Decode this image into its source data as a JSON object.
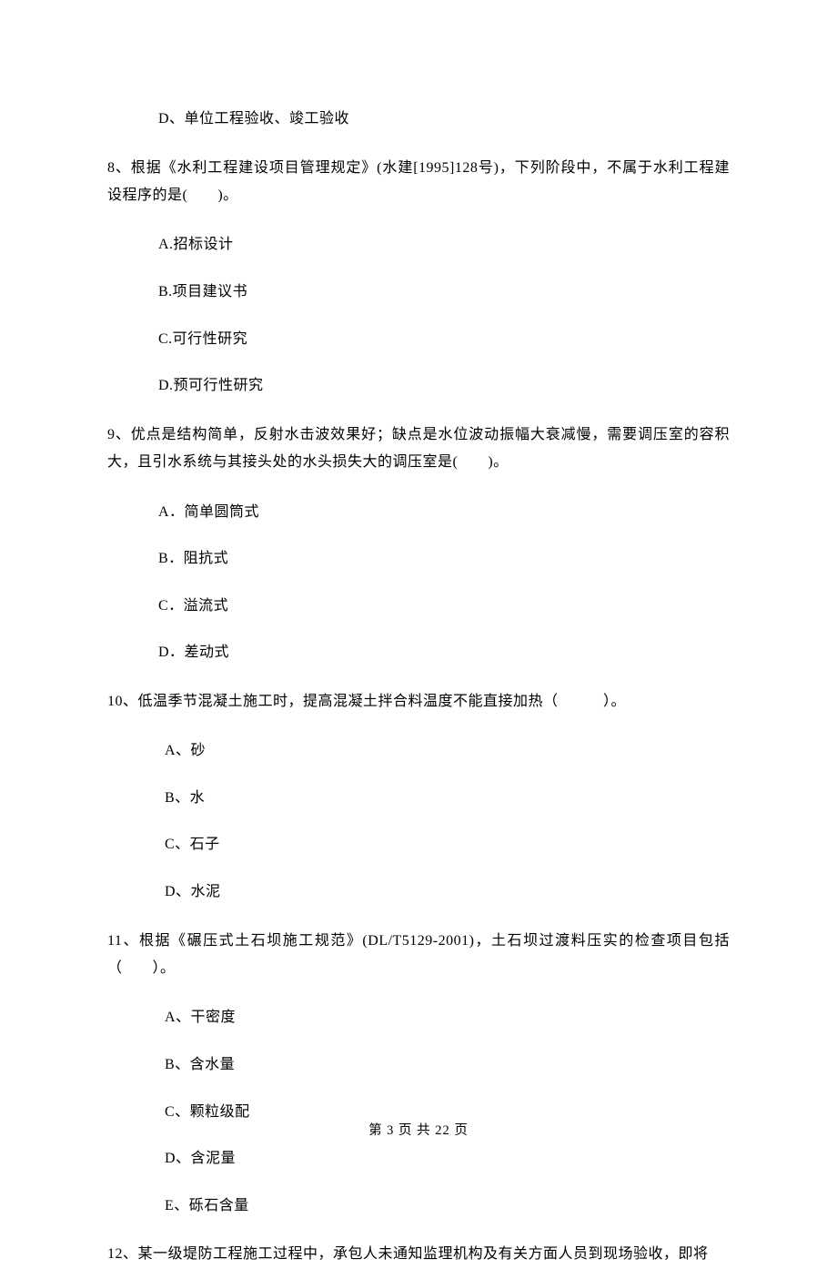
{
  "q7": {
    "optD": "D、单位工程验收、竣工验收"
  },
  "q8": {
    "text": "8、根据《水利工程建设项目管理规定》(水建[1995]128号)，下列阶段中，不属于水利工程建设程序的是(　　)。",
    "optA": "A.招标设计",
    "optB": "B.项目建议书",
    "optC": "C.可行性研究",
    "optD": "D.预可行性研究"
  },
  "q9": {
    "text": "9、优点是结构简单，反射水击波效果好；缺点是水位波动振幅大衰减慢，需要调压室的容积大，且引水系统与其接头处的水头损失大的调压室是(　　)。",
    "optA": "A．简单圆筒式",
    "optB": "B．阻抗式",
    "optC": "C．溢流式",
    "optD": "D．差动式"
  },
  "q10": {
    "text": "10、低温季节混凝土施工时，提高混凝土拌合料温度不能直接加热（　　　）。",
    "optA": "A、砂",
    "optB": "B、水",
    "optC": "C、石子",
    "optD": "D、水泥"
  },
  "q11": {
    "text": "11、根据《碾压式土石坝施工规范》(DL/T5129-2001)，土石坝过渡料压实的检查项目包括（　　）。",
    "optA": "A、干密度",
    "optB": "B、含水量",
    "optC": "C、颗粒级配",
    "optD": "D、含泥量",
    "optE": "E、砾石含量"
  },
  "q12": {
    "text": "12、某一级堤防工程施工过程中，承包人未通知监理机构及有关方面人员到现场验收，即将"
  },
  "footer": "第 3 页 共 22 页"
}
